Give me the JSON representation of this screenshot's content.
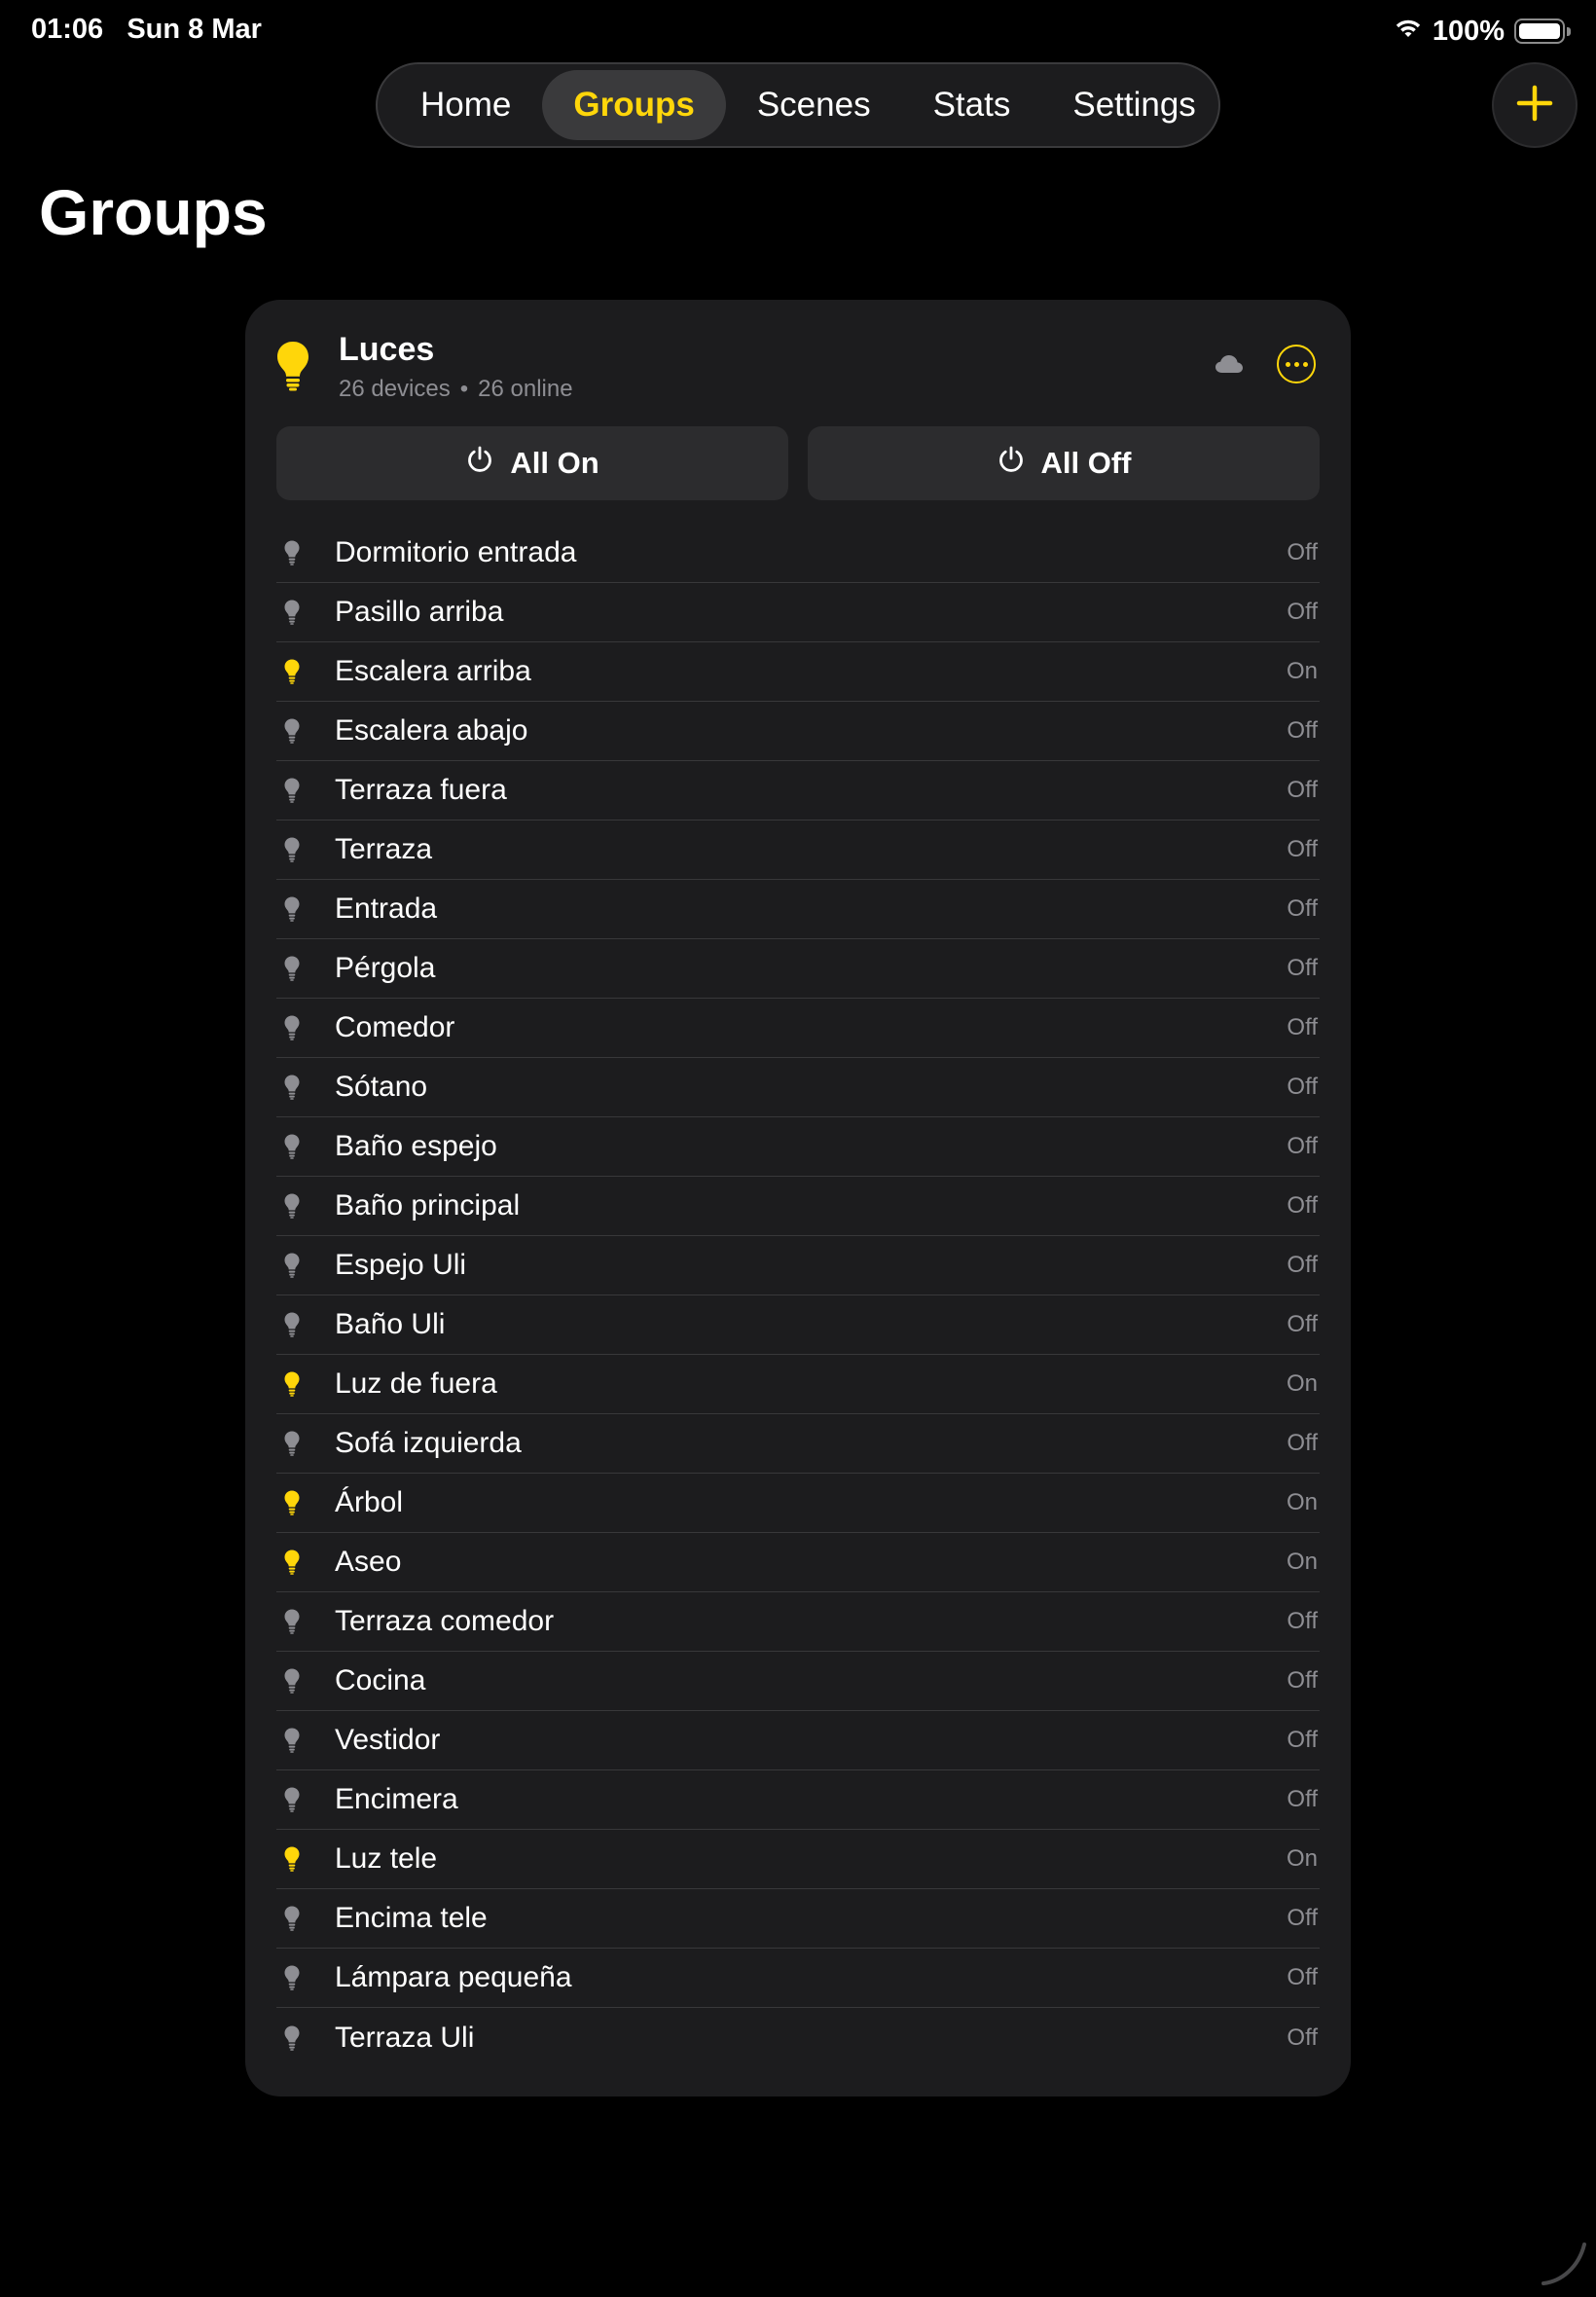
{
  "status_bar": {
    "time": "01:06",
    "date": "Sun 8 Mar",
    "battery_percent": "100%",
    "battery_level": 1.0,
    "icons": [
      "wifi-icon",
      "battery-icon"
    ]
  },
  "nav": {
    "tabs": [
      {
        "label": "Home",
        "active": false
      },
      {
        "label": "Groups",
        "active": true
      },
      {
        "label": "Scenes",
        "active": false
      },
      {
        "label": "Stats",
        "active": false
      },
      {
        "label": "Settings",
        "active": false
      }
    ],
    "add_icon": "plus-icon"
  },
  "page": {
    "title": "Groups"
  },
  "group": {
    "name": "Luces",
    "device_count": "26 devices",
    "separator": "•",
    "online_count": "26 online",
    "icons": {
      "group": "lightbulb-icon",
      "cloud": "cloud-icon",
      "more": "more-icon"
    },
    "all_on_label": "All On",
    "all_off_label": "All Off",
    "devices": [
      {
        "name": "Dormitorio entrada",
        "state": "Off"
      },
      {
        "name": "Pasillo arriba",
        "state": "Off"
      },
      {
        "name": "Escalera arriba",
        "state": "On"
      },
      {
        "name": "Escalera abajo",
        "state": "Off"
      },
      {
        "name": "Terraza fuera",
        "state": "Off"
      },
      {
        "name": "Terraza",
        "state": "Off"
      },
      {
        "name": "Entrada",
        "state": "Off"
      },
      {
        "name": "Pérgola",
        "state": "Off"
      },
      {
        "name": "Comedor",
        "state": "Off"
      },
      {
        "name": "Sótano",
        "state": "Off"
      },
      {
        "name": "Baño espejo",
        "state": "Off"
      },
      {
        "name": "Baño principal",
        "state": "Off"
      },
      {
        "name": "Espejo Uli",
        "state": "Off"
      },
      {
        "name": "Baño Uli",
        "state": "Off"
      },
      {
        "name": "Luz de fuera",
        "state": "On"
      },
      {
        "name": "Sofá izquierda",
        "state": "Off"
      },
      {
        "name": "Árbol",
        "state": "On"
      },
      {
        "name": "Aseo",
        "state": "On"
      },
      {
        "name": "Terraza comedor",
        "state": "Off"
      },
      {
        "name": "Cocina",
        "state": "Off"
      },
      {
        "name": "Vestidor",
        "state": "Off"
      },
      {
        "name": "Encimera",
        "state": "Off"
      },
      {
        "name": "Luz tele",
        "state": "On"
      },
      {
        "name": "Encima tele",
        "state": "Off"
      },
      {
        "name": "Lámpara pequeña",
        "state": "Off"
      },
      {
        "name": "Terraza Uli",
        "state": "Off"
      }
    ]
  },
  "colors": {
    "accent": "#ffd60a",
    "background": "#000000",
    "card": "#1c1c1e",
    "button": "#2c2c2e",
    "bulb_off": "#8e8e93",
    "secondary_text": "#8e8e93"
  }
}
